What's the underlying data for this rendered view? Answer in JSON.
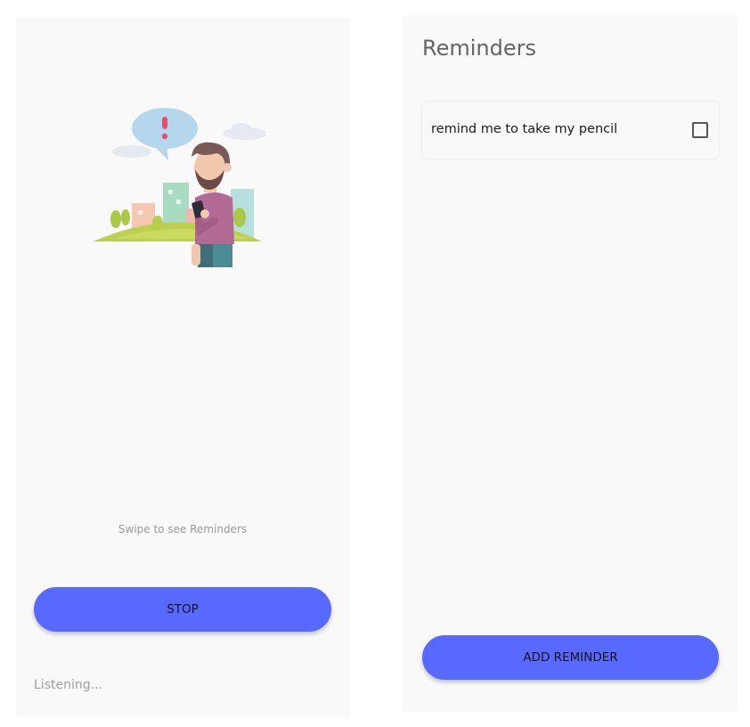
{
  "listening_screen": {
    "hint": "Swipe  to see Reminders",
    "stop_label": "STOP",
    "status": "Listening..."
  },
  "reminders_screen": {
    "title": "Reminders",
    "items": [
      {
        "text": "remind me to take my pencil",
        "checked": false
      }
    ],
    "add_label": "ADD REMINDER"
  },
  "colors": {
    "accent": "#5769fe",
    "background": "#f9f9fa"
  }
}
